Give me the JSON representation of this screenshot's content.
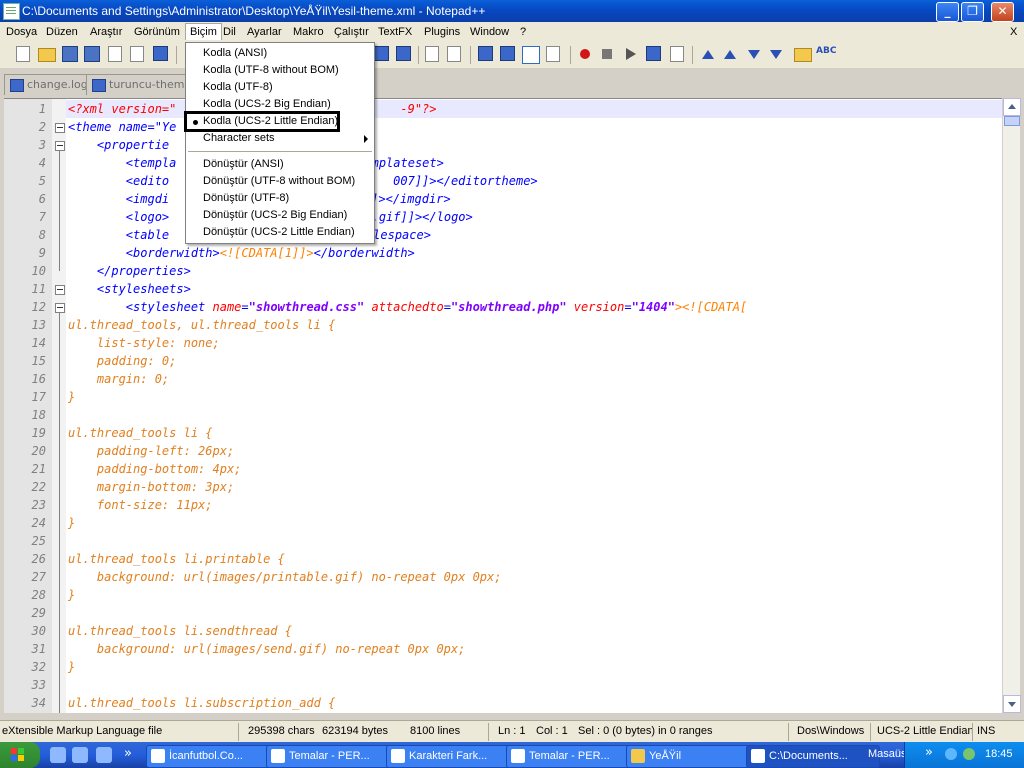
{
  "window": {
    "title": "C:\\Documents and Settings\\Administrator\\Desktop\\YeÅŸil\\Yesil-theme.xml - Notepad++"
  },
  "menubar": [
    "Dosya",
    "Düzen",
    "Araştır",
    "Görünüm",
    "Biçim",
    "Dil",
    "Ayarlar",
    "Makro",
    "Çalıştır",
    "TextFX",
    "Plugins",
    "Window",
    "?"
  ],
  "menubar_close": "X",
  "tabs": [
    "change.log",
    "turuncu-theme.x"
  ],
  "dropdown": {
    "items_a": [
      "Kodla (ANSI)",
      "Kodla (UTF-8 without BOM)",
      "Kodla (UTF-8)",
      "Kodla (UCS-2 Big Endian)"
    ],
    "selected": "Kodla (UCS-2 Little Endian)",
    "charsets": "Character sets",
    "items_b": [
      "Dönüştür (ANSI)",
      "Dönüştür (UTF-8 without BOM)",
      "Dönüştür (UTF-8)",
      "Dönüştür (UCS-2 Big Endian)",
      "Dönüştür (UCS-2 Little Endian)"
    ]
  },
  "line_numbers": [
    "1",
    "2",
    "3",
    "4",
    "5",
    "6",
    "7",
    "8",
    "9",
    "10",
    "11",
    "12",
    "13",
    "14",
    "15",
    "16",
    "17",
    "18",
    "19",
    "20",
    "21",
    "22",
    "23",
    "24",
    "25",
    "26",
    "27",
    "28",
    "29",
    "30",
    "31",
    "32",
    "33",
    "34"
  ],
  "code": {
    "l1a": "<?xml version=\"",
    "l1b": "-9\"?>",
    "l2a": "<theme name=\"Ye",
    "l3": "    <propertie",
    "l4a": "        <templa",
    "l4b": "emplateset>",
    "l5a": "        <edito",
    "l5b": "007]]></editortheme>",
    "l6a": "        <imgdi",
    "l6b": "]></imgdir>",
    "l7a": "        <logo>",
    "l7b": "go.gif]]></logo>",
    "l8a": "        <table",
    "l8b": "lespace>",
    "l9a": "        <borderwidth>",
    "l9b": "<![CDATA[1]]>",
    "l9c": "</borderwidth>",
    "l10": "    </properties>",
    "l11": "    <stylesheets>",
    "l12a": "        <stylesheet ",
    "l12b": "name",
    "l12c": "=",
    "l12d": "\"showthread.css\"",
    "l12e": "attachedto",
    "l12f": "\"showthread.php\"",
    "l12g": "version",
    "l12h": "\"1404\"",
    "l12i": "><![CDATA[",
    "css": [
      "ul.thread_tools, ul.thread_tools li {",
      "    list-style: none;",
      "    padding: 0;",
      "    margin: 0;",
      "}",
      "",
      "ul.thread_tools li {",
      "    padding-left: 26px;",
      "    padding-bottom: 4px;",
      "    margin-bottom: 3px;",
      "    font-size: 11px;",
      "}",
      "",
      "ul.thread_tools li.printable {",
      "    background: url(images/printable.gif) no-repeat 0px 0px;",
      "}",
      "",
      "ul.thread_tools li.sendthread {",
      "    background: url(images/send.gif) no-repeat 0px 0px;",
      "}",
      "",
      "ul.thread_tools li.subscription_add {"
    ]
  },
  "status": {
    "filetype": "eXtensible Markup Language file",
    "chars": "295398 chars",
    "bytes": "623194 bytes",
    "lines": "8100 lines",
    "ln": "Ln : 1",
    "col": "Col : 1",
    "sel": "Sel : 0 (0 bytes) in 0 ranges",
    "eol": "Dos\\Windows",
    "encoding": "UCS-2 Little Endian",
    "mode": "INS"
  },
  "taskbar": {
    "overflow": "»",
    "tasks": [
      "İcanfutbol.Co...",
      "Temalar - PER...",
      "Karakteri Fark...",
      "Temalar - PER...",
      "YeÅŸil",
      "C:\\Documents..."
    ],
    "desktop": "Masaüstü",
    "tray_overflow": "»",
    "clock": "18:45"
  },
  "colors": {
    "title_blue": "#0748c2",
    "menu_bg": "#ece9d8",
    "tag": "#0000ff",
    "attr": "#ff0000",
    "cdata": "#ff8000"
  }
}
